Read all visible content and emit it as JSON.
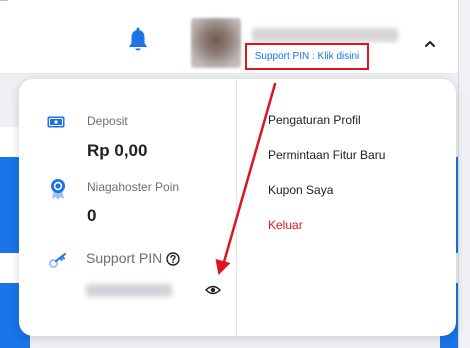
{
  "header": {
    "notification_icon": "bell-icon",
    "support_pin_link": "Support PIN : Klik disini",
    "expand_icon": "chevron-up-icon"
  },
  "account": {
    "deposit": {
      "label": "Deposit",
      "value": "Rp 0,00",
      "icon": "wallet-icon"
    },
    "points": {
      "label": "Niagahoster Poin",
      "value": "0",
      "icon": "medal-icon"
    },
    "support_pin": {
      "label": "Support PIN",
      "icon": "key-icon",
      "help_icon": "help-icon",
      "toggle_icon": "eye-icon"
    }
  },
  "menu": {
    "items": [
      {
        "label": "Pengaturan Profil"
      },
      {
        "label": "Permintaan Fitur Baru"
      },
      {
        "label": "Kupon Saya"
      },
      {
        "label": "Keluar",
        "color": "#e0141e"
      }
    ]
  },
  "colors": {
    "accent": "#1a73e8",
    "highlight": "#e0141e"
  }
}
